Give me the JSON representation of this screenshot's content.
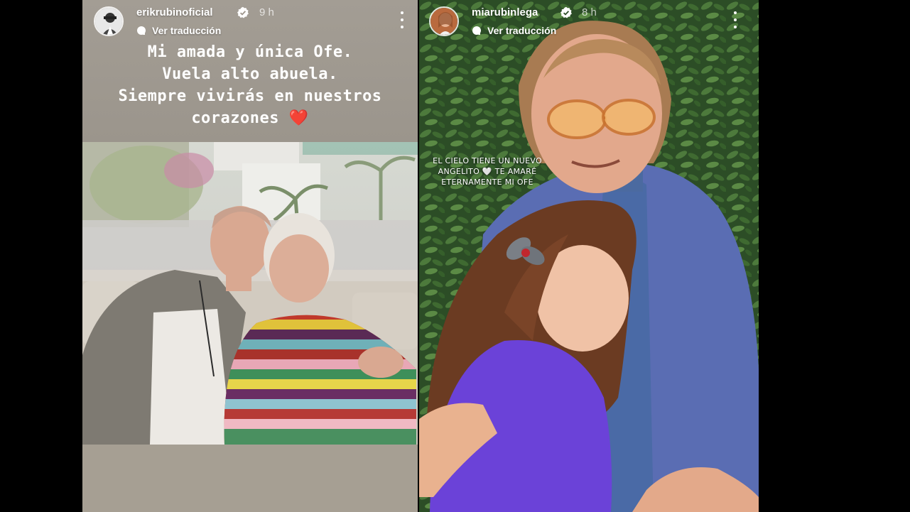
{
  "stories": {
    "left": {
      "username": "erikrubinoficial",
      "time": "9 h",
      "translate_label": "Ver traducción",
      "caption_lines": [
        "Mi amada y única Ofe.",
        "Vuela alto abuela.",
        "Siempre vivirás en nuestros",
        "corazones"
      ],
      "caption_emoji": "❤️"
    },
    "right": {
      "username": "miarubinlega",
      "time": "8 h",
      "translate_label": "Ver traducción",
      "overlay_lines": [
        "EL CIELO TIENE UN NUEVO",
        "ANGELITO 🤍 TE AMARÉ",
        "ETERNAMENTE MI OFE"
      ]
    }
  },
  "icons": {
    "verified": "verified-badge-icon",
    "translate": "translate-dot-icon",
    "more": "more-options-icon"
  },
  "colors": {
    "background": "#000000",
    "left_band": "#9e968c",
    "verified": "#ffffff",
    "heart": "#e0102a"
  }
}
